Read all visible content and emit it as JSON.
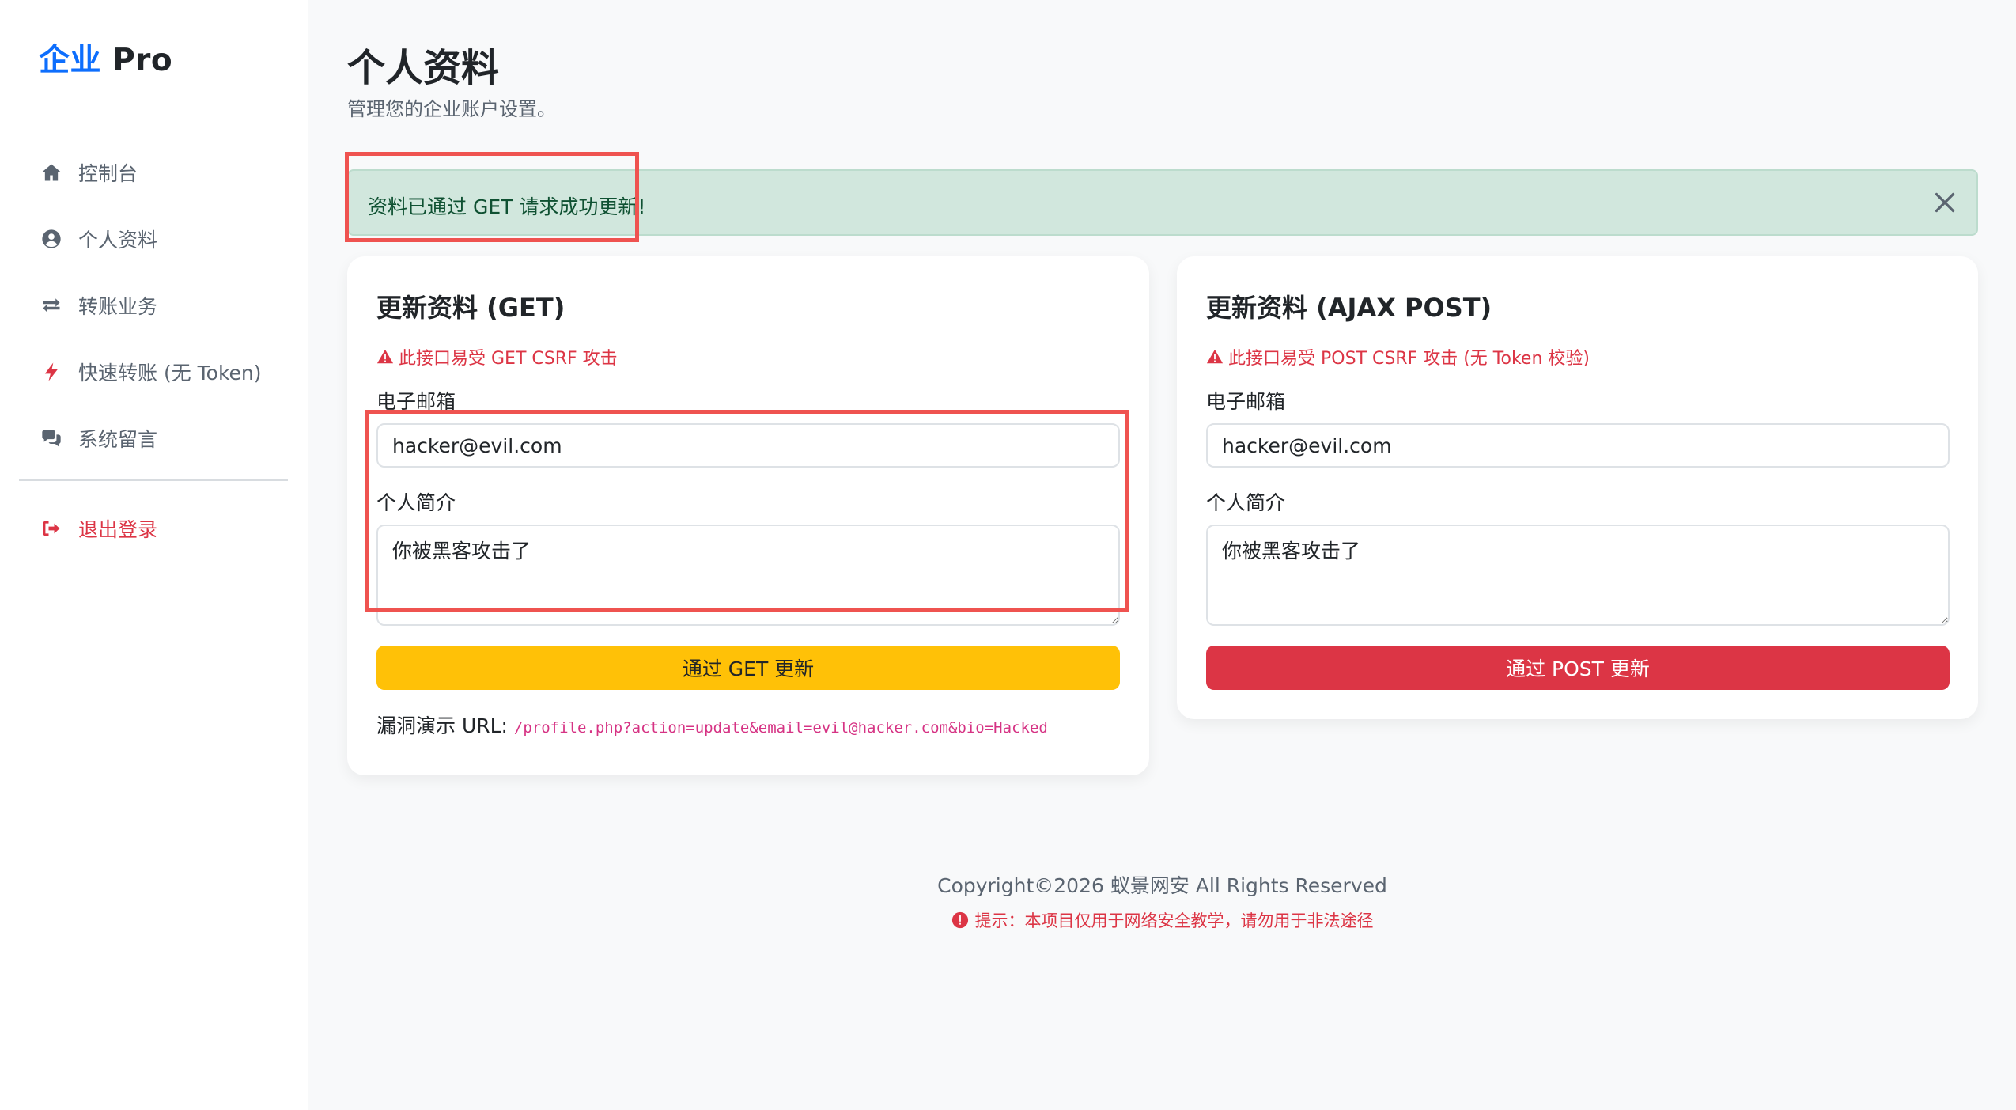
{
  "brand": {
    "accent": "企业",
    "name": " Pro"
  },
  "sidebar": {
    "items": [
      {
        "label": "控制台",
        "icon": "home-icon"
      },
      {
        "label": "个人资料",
        "icon": "user-circle-icon"
      },
      {
        "label": "转账业务",
        "icon": "exchange-icon"
      },
      {
        "label": "快速转账 (无 Token)",
        "icon": "bolt-icon"
      },
      {
        "label": "系统留言",
        "icon": "comments-icon"
      }
    ],
    "logout": {
      "label": "退出登录",
      "icon": "sign-out-icon"
    }
  },
  "page": {
    "title": "个人资料",
    "subtitle": "管理您的企业账户设置。"
  },
  "alert": {
    "text": "资料已通过 GET 请求成功更新!",
    "color": "#d1e7dd"
  },
  "get_card": {
    "title": "更新资料 (GET)",
    "warning": "此接口易受 GET CSRF 攻击",
    "email_label": "电子邮箱",
    "email_value": "hacker@evil.com",
    "bio_label": "个人简介",
    "bio_value": "你被黑客攻击了",
    "button": "通过 GET 更新",
    "url_label": "漏洞演示 URL: ",
    "url_value": "/profile.php?action=update&email=evil@hacker.com&bio=Hacked"
  },
  "post_card": {
    "title": "更新资料 (AJAX POST)",
    "warning": "此接口易受 POST CSRF 攻击 (无 Token 校验)",
    "email_label": "电子邮箱",
    "email_value": "hacker@evil.com",
    "bio_label": "个人简介",
    "bio_value": "你被黑客攻击了",
    "button": "通过 POST 更新"
  },
  "footer": {
    "copyright": "Copyright©2026 蚁景网安 All Rights Reserved",
    "warning": "提示：本项目仅用于网络安全教学，请勿用于非法途径"
  },
  "colors": {
    "primary": "#0d6efd",
    "danger": "#dc3545",
    "warning": "#ffc107",
    "highlight": "#ef5350"
  }
}
